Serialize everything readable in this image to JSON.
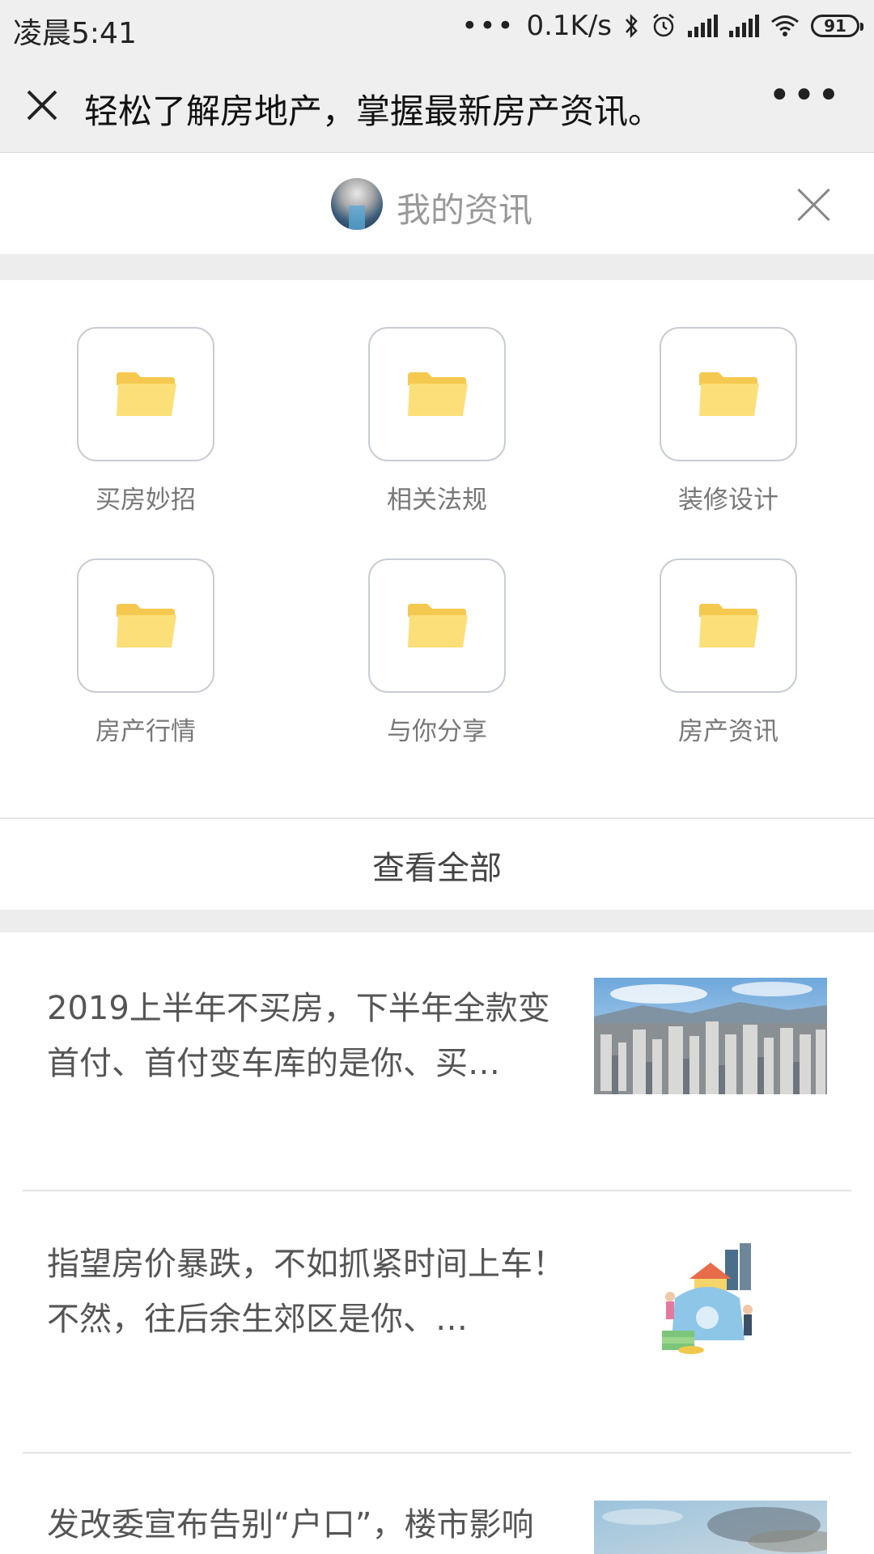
{
  "status_bar": {
    "time": "凌晨5:41",
    "more": "•••",
    "speed": "0.1K/s",
    "battery": "91"
  },
  "nav": {
    "title": "轻松了解房地产，掌握最新房产资讯。",
    "more": "•••"
  },
  "header": {
    "title": "我的资讯"
  },
  "categories": [
    {
      "label": "买房妙招",
      "icon": "folder-icon"
    },
    {
      "label": "相关法规",
      "icon": "folder-icon"
    },
    {
      "label": "装修设计",
      "icon": "folder-icon"
    },
    {
      "label": "房产行情",
      "icon": "folder-icon"
    },
    {
      "label": "与你分享",
      "icon": "folder-icon"
    },
    {
      "label": "房产资讯",
      "icon": "folder-icon"
    }
  ],
  "view_all": "查看全部",
  "articles": [
    {
      "title": "2019上半年不买房，下半年全款变首付、首付变车库的是你、买…",
      "thumb": "city-skyline-image"
    },
    {
      "title": "指望房价暴跌，不如抓紧时间上车！不然，往后余生郊区是你、…",
      "thumb": "house-money-illustration"
    },
    {
      "title": "发改委宣布告别“户口”，楼市影响",
      "thumb": "sky-photo"
    }
  ],
  "colors": {
    "bar_bg": "#efefef",
    "folder": "#fbe07a",
    "gap": "#ededed"
  }
}
